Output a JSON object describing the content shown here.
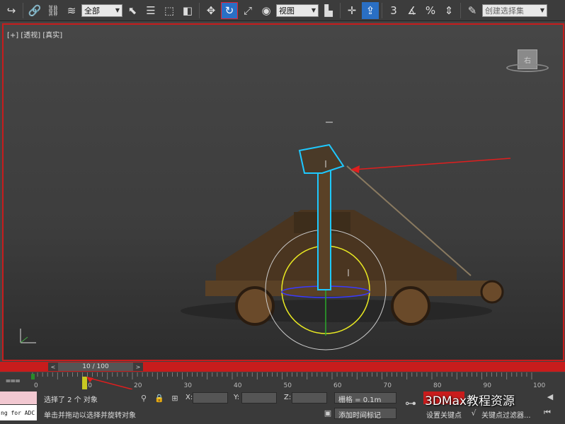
{
  "toolbar": {
    "filter_select": "全部",
    "ref_coord_select": "视图",
    "named_selection": "创建选择集",
    "snap_icons": [
      "3",
      "%"
    ]
  },
  "viewport": {
    "label": "[+] [透视] [真实]",
    "viewcube_label": "右"
  },
  "timeline": {
    "frame_display": "10 / 100",
    "frame_labels": [
      "0",
      "10",
      "20",
      "30",
      "40",
      "50",
      "60",
      "70",
      "80",
      "90",
      "100"
    ],
    "current_frame": 10
  },
  "status": {
    "selected": "选择了 2 个 对象",
    "prompt": "单击并拖动以选择并旋转对象",
    "x_label": "X:",
    "y_label": "Y:",
    "z_label": "Z:",
    "grid": "栅格 = 0.1m",
    "add_time_tag": "添加时间标记",
    "set_key": "设置关键点",
    "key_filters": "关键点过滤器...",
    "maxscript_text": "ng for ADC",
    "watermark": "3DMax教程资源"
  },
  "colors": {
    "accent_red": "#c81c1c",
    "active_blue": "#2a6fc4",
    "selection_cyan": "#1ec8ff"
  }
}
